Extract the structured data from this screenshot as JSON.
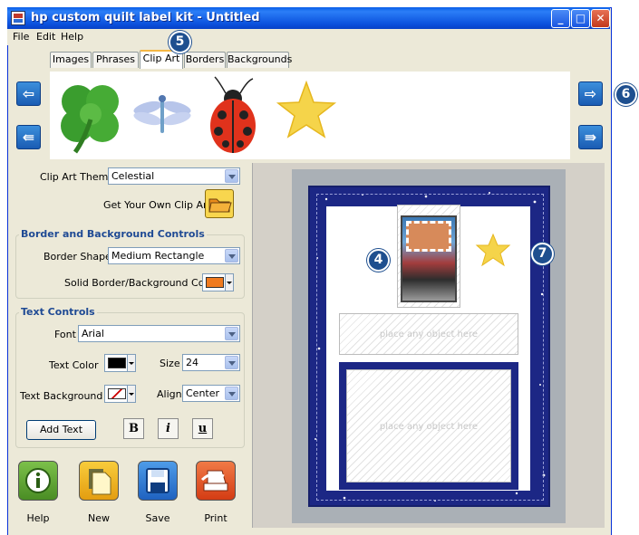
{
  "window": {
    "title": "hp custom quilt label kit - Untitled",
    "minimize_glyph": "_",
    "maximize_glyph": "□",
    "close_glyph": "✕"
  },
  "menu": {
    "file": "File",
    "edit": "Edit",
    "help": "Help"
  },
  "tabs": [
    "Images",
    "Phrases",
    "Clip Art",
    "Borders",
    "Backgrounds"
  ],
  "active_tab": "Clip Art",
  "clip_art": [
    "shamrock",
    "dragonfly",
    "ladybug",
    "star"
  ],
  "nav": {
    "left": "⇦",
    "left_fast": "⇚",
    "right": "⇨",
    "right_fast": "⇛"
  },
  "callouts": {
    "tab": "5",
    "nav": "6",
    "photo": "4",
    "star": "7"
  },
  "clip_art_theme": {
    "label": "Clip Art Theme",
    "value": "Celestial"
  },
  "get_clip_art": {
    "label": "Get Your Own Clip Art"
  },
  "border_group": {
    "title": "Border and Background Controls",
    "shape_label": "Border Shape",
    "shape_value": "Medium Rectangle",
    "color_label": "Solid Border/Background Color",
    "color": "#f07a1e"
  },
  "text_group": {
    "title": "Text Controls",
    "font_label": "Font",
    "font_value": "Arial",
    "text_color_label": "Text Color",
    "text_color": "#000000",
    "size_label": "Size",
    "size_value": "24",
    "text_bg_label": "Text Background",
    "align_label": "Align",
    "align_value": "Center",
    "add_text": "Add Text",
    "bold": "B",
    "italic": "i",
    "underline": "u"
  },
  "tools": [
    {
      "label": "Help",
      "icon": "info-icon",
      "color": "#5aa02c"
    },
    {
      "label": "New",
      "icon": "new-document-icon",
      "color": "#f2b41e"
    },
    {
      "label": "Save",
      "icon": "save-icon",
      "color": "#2f7fd4"
    },
    {
      "label": "Print",
      "icon": "printer-icon",
      "color": "#e8522a"
    }
  ],
  "label_preview": {
    "placeholder_1": "place any object here",
    "placeholder_2": "place any object here",
    "border_color": "#1c2785"
  }
}
